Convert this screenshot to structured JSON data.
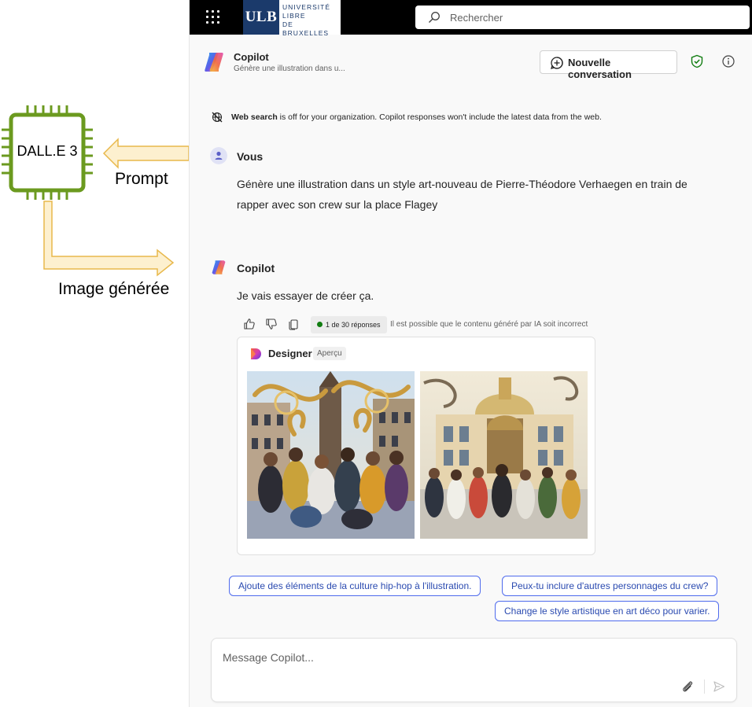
{
  "diagram": {
    "chip_label": "DALL.E 3",
    "prompt_label": "Prompt",
    "image_label": "Image générée",
    "chip_color": "#6b9a1f",
    "arrow_fill": "#fdf0cf",
    "arrow_stroke": "#e8b84b"
  },
  "topbar": {
    "launcher_icon": "waffle-icon",
    "university": {
      "abbr": "ULB",
      "line1": "UNIVERSITÉ",
      "line2": "LIBRE",
      "line3": "DE BRUXELLES"
    },
    "search": {
      "placeholder": "Rechercher",
      "icon": "search-icon"
    }
  },
  "header": {
    "title": "Copilot",
    "subtitle": "Génère une illustration dans u...",
    "new_conversation_label": "Nouvelle conversation",
    "shield_color": "#107c10"
  },
  "notice": {
    "bold": "Web search",
    "text": " is off for your organization. Copilot responses won't include the latest data from the web."
  },
  "messages": {
    "user": {
      "author": "Vous",
      "line1": "Génère une illustration dans un style art-nouveau de Pierre-Théodore Verhaegen en train de",
      "line2": "rapper avec son crew sur la place Flagey"
    },
    "assistant": {
      "author": "Copilot",
      "text": "Je vais essayer de créer ça."
    }
  },
  "reactions": {
    "response_count": "1 de 30 réponses",
    "disclaimer": "Il est possible que le contenu généré par IA soit incorrect"
  },
  "designer": {
    "title": "Designer",
    "badge": "Aperçu"
  },
  "suggestions": [
    "Ajoute des éléments de la culture hip-hop à l'illustration.",
    "Peux-tu inclure d'autres personnages du crew?",
    "Change le style artistique en art déco pour varier."
  ],
  "composer": {
    "placeholder": "Message Copilot..."
  }
}
